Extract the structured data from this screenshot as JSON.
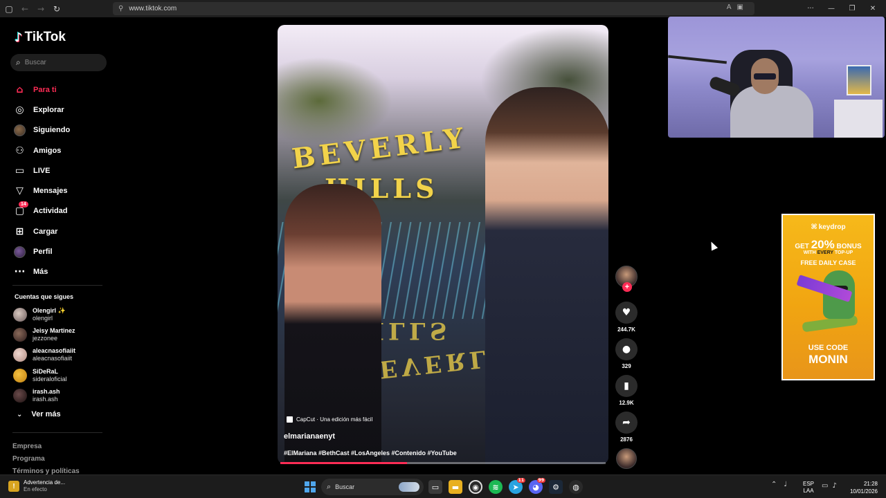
{
  "browser": {
    "url": "www.tiktok.com"
  },
  "app": {
    "logo_text": "TikTok",
    "search_placeholder": "Buscar"
  },
  "nav": [
    {
      "label": "Para ti",
      "icon": "home-icon",
      "active": true
    },
    {
      "label": "Explorar",
      "icon": "compass-icon"
    },
    {
      "label": "Siguiendo",
      "icon": "avatar-icon"
    },
    {
      "label": "Amigos",
      "icon": "friends-icon"
    },
    {
      "label": "LIVE",
      "icon": "live-icon"
    },
    {
      "label": "Mensajes",
      "icon": "messages-icon"
    },
    {
      "label": "Actividad",
      "icon": "activity-icon",
      "badge": "14"
    },
    {
      "label": "Cargar",
      "icon": "upload-icon"
    },
    {
      "label": "Perfil",
      "icon": "profile-icon"
    },
    {
      "label": "Más",
      "icon": "more-icon"
    }
  ],
  "following": {
    "title": "Cuentas que sigues",
    "accounts": [
      {
        "name": "Olengirl ✨",
        "username": "olengirl"
      },
      {
        "name": "Jeisy Martinez",
        "username": "jezzonee"
      },
      {
        "name": "aleacnasofiaiit",
        "username": "aleacnasofiaiit"
      },
      {
        "name": "SiDeRaL",
        "username": "sideraloficial"
      },
      {
        "name": "irash.ash",
        "username": "irash.ash"
      }
    ],
    "see_more": "Ver más"
  },
  "footer": [
    "Empresa",
    "Programa",
    "Términos y políticas"
  ],
  "video": {
    "scene_text_top": "BEVERLY",
    "scene_text_bottom": "HILLS",
    "capcut_tag": "CapCut · Una edición más fácil",
    "author": "elmarianaenyt",
    "hashtags": "#ElMariana #BethCast #LosAngeles #Contenido #YouTube",
    "progress": 0.39
  },
  "actions": {
    "likes": "244.7K",
    "comments": "329",
    "saves": "12.9K",
    "shares": "2876"
  },
  "ad": {
    "brand": "keydrop",
    "line1_prefix": "GET",
    "line1_pct": "20%",
    "line1_suffix": "BONUS",
    "line2_a": "WITH",
    "line2_b": "EVERY",
    "line2_c": "TOP-UP",
    "line3": "FREE DAILY CASE",
    "line4": "USE CODE",
    "code": "MONIN"
  },
  "taskbar": {
    "alert_title": "Advertencia de...",
    "alert_sub": "En efecto",
    "search_label": "Buscar",
    "lang_top": "ESP",
    "lang_bottom": "LAA",
    "time": "21:28",
    "date": "10/01/2026",
    "app_badges": {
      "telegram": "11",
      "discord": "99"
    }
  },
  "colors": {
    "accent": "#fe2c55",
    "background": "#000000",
    "ad_background": "#f6b91a"
  }
}
